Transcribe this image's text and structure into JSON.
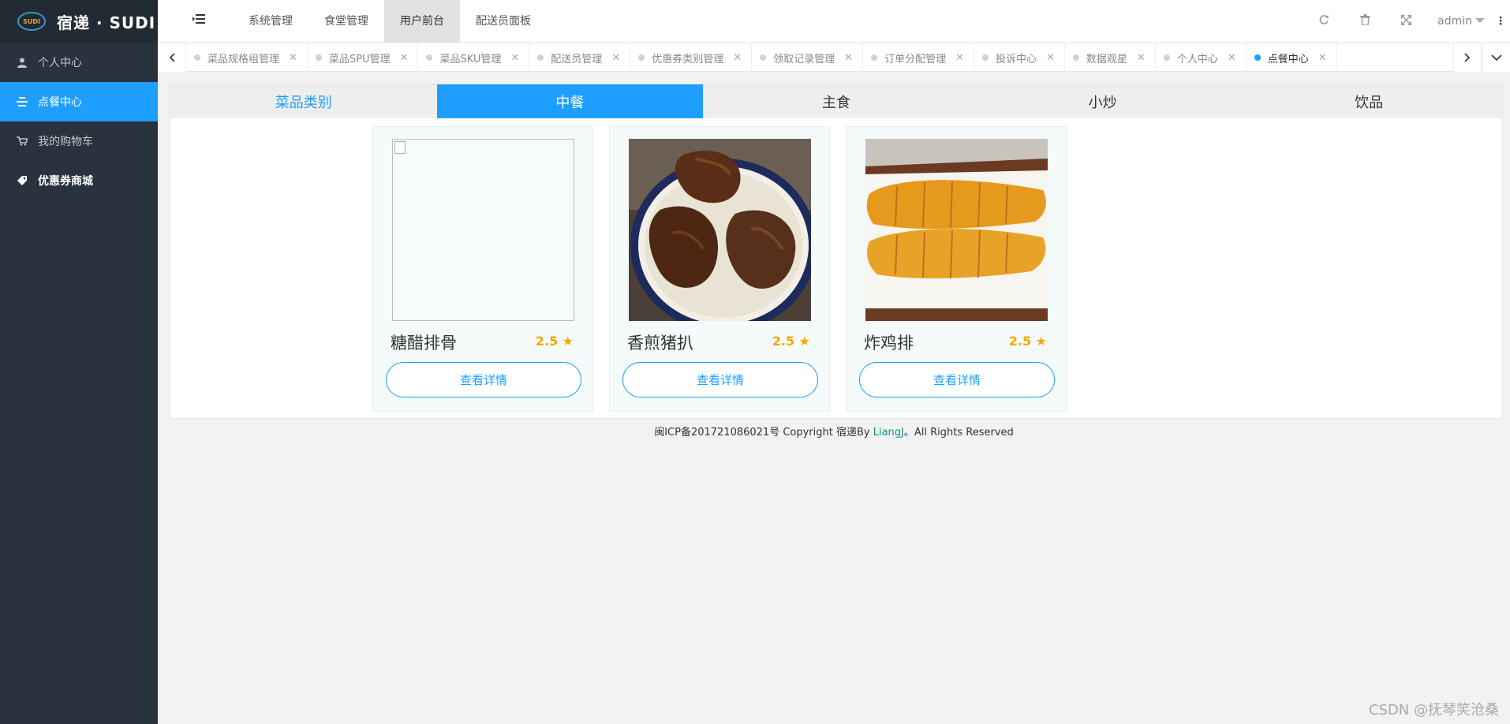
{
  "app": {
    "name": "宿递 · SUDI",
    "logo_text": "SUDI"
  },
  "sidebar": {
    "items": [
      {
        "label": "个人中心",
        "icon": "user-icon"
      },
      {
        "label": "点餐中心",
        "icon": "list-icon"
      },
      {
        "label": "我的购物车",
        "icon": "cart-icon"
      },
      {
        "label": "优惠券商城",
        "icon": "tag-icon"
      }
    ]
  },
  "header": {
    "menu": [
      "系统管理",
      "食堂管理",
      "用户前台",
      "配送员面板"
    ],
    "user": "admin"
  },
  "tabs": [
    {
      "label": "菜品规格组管理"
    },
    {
      "label": "菜品SPU管理"
    },
    {
      "label": "菜品SKU管理"
    },
    {
      "label": "配送员管理"
    },
    {
      "label": "优惠券类别管理"
    },
    {
      "label": "领取记录管理"
    },
    {
      "label": "订单分配管理"
    },
    {
      "label": "投诉中心"
    },
    {
      "label": "数据观星"
    },
    {
      "label": "个人中心"
    },
    {
      "label": "点餐中心"
    }
  ],
  "categories": {
    "label": "菜品类别",
    "items": [
      "中餐",
      "主食",
      "小炒",
      "饮品"
    ]
  },
  "dishes": [
    {
      "name": "糖醋排骨",
      "rating": "2.5",
      "button": "查看详情"
    },
    {
      "name": "香煎猪扒",
      "rating": "2.5",
      "button": "查看详情"
    },
    {
      "name": "炸鸡排",
      "rating": "2.5",
      "button": "查看详情"
    }
  ],
  "footer": {
    "text": "闽ICP备201721086021号 Copyright 宿递By",
    "link": "LiangJ",
    "suffix": "。All Rights Reserved"
  },
  "watermark": "CSDN @抚琴笑沧桑",
  "colors": {
    "accent": "#1e9fff",
    "sidebar": "#28333e",
    "star": "#f5a800"
  }
}
